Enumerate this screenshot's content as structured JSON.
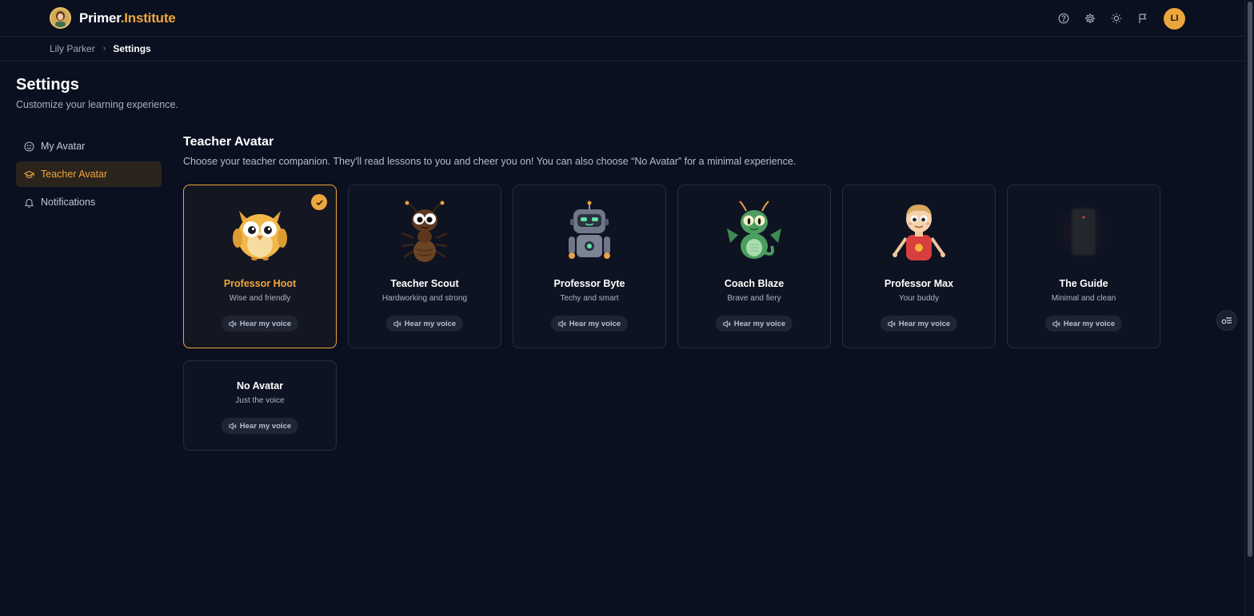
{
  "app": {
    "brand_primary": "Primer",
    "brand_secondary": ".Institute",
    "accent": "#eda63d"
  },
  "header": {
    "icons": [
      "help-icon",
      "gear-icon",
      "sun-icon",
      "flag-icon"
    ],
    "user_initials": "LI"
  },
  "breadcrumb": {
    "parent": "Lily Parker",
    "current": "Settings"
  },
  "page": {
    "title": "Settings",
    "subtitle": "Customize your learning experience."
  },
  "sidebar": {
    "items": [
      {
        "label": "My Avatar",
        "icon": "smile-icon",
        "active": false
      },
      {
        "label": "Teacher Avatar",
        "icon": "graduation-cap-icon",
        "active": true
      },
      {
        "label": "Notifications",
        "icon": "bell-icon",
        "active": false
      }
    ]
  },
  "section": {
    "title": "Teacher Avatar",
    "description": "Choose your teacher companion. They'll read lessons to you and cheer you on! You can also choose “No Avatar” for a minimal experience."
  },
  "avatars": [
    {
      "name": "Professor Hoot",
      "tagline": "Wise and friendly",
      "voice_label": "Hear my voice",
      "selected": true,
      "icon": "owl-icon"
    },
    {
      "name": "Teacher Scout",
      "tagline": "Hardworking and strong",
      "voice_label": "Hear my voice",
      "selected": false,
      "icon": "ant-icon"
    },
    {
      "name": "Professor Byte",
      "tagline": "Techy and smart",
      "voice_label": "Hear my voice",
      "selected": false,
      "icon": "robot-icon"
    },
    {
      "name": "Coach Blaze",
      "tagline": "Brave and fiery",
      "voice_label": "Hear my voice",
      "selected": false,
      "icon": "dragon-icon"
    },
    {
      "name": "Professor Max",
      "tagline": "Your buddy",
      "voice_label": "Hear my voice",
      "selected": false,
      "icon": "boy-icon"
    },
    {
      "name": "The Guide",
      "tagline": "Minimal and clean",
      "voice_label": "Hear my voice",
      "selected": false,
      "icon": "device-icon"
    },
    {
      "name": "No Avatar",
      "tagline": "Just the voice",
      "voice_label": "Hear my voice",
      "selected": false,
      "icon": ""
    }
  ]
}
